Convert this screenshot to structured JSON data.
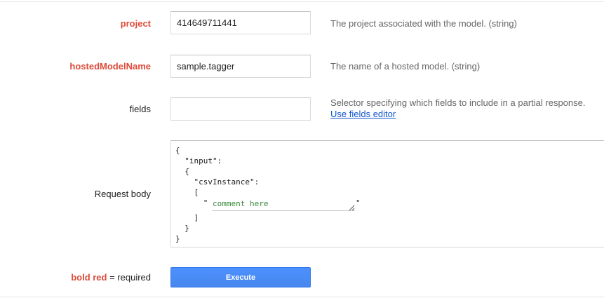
{
  "legend": {
    "required_word": "bold red",
    "rest": " = required"
  },
  "fields": [
    {
      "label": "project",
      "required": true,
      "value": "414649711441",
      "description": "The project associated with the model. (string)"
    },
    {
      "label": "hostedModelName",
      "required": true,
      "value": "sample.tagger",
      "description": "The name of a hosted model. (string)"
    },
    {
      "label": "fields",
      "required": false,
      "value": "",
      "description": "Selector specifying which fields to include in a partial response.",
      "link": "Use fields editor"
    }
  ],
  "request_body": {
    "label": "Request body",
    "lines": [
      "{",
      "  \"input\":",
      "  {",
      "    \"csvInstance\":",
      "    [",
      "      \"",
      "    ]",
      "  }",
      "}"
    ],
    "closing_quote": "\"",
    "comment_placeholder": "comment here"
  },
  "execute": {
    "label": "Execute"
  },
  "colors": {
    "required": "#dd4b39",
    "link": "#1155cc",
    "button": "#4d90fe",
    "comment": "#3c8a3c"
  }
}
